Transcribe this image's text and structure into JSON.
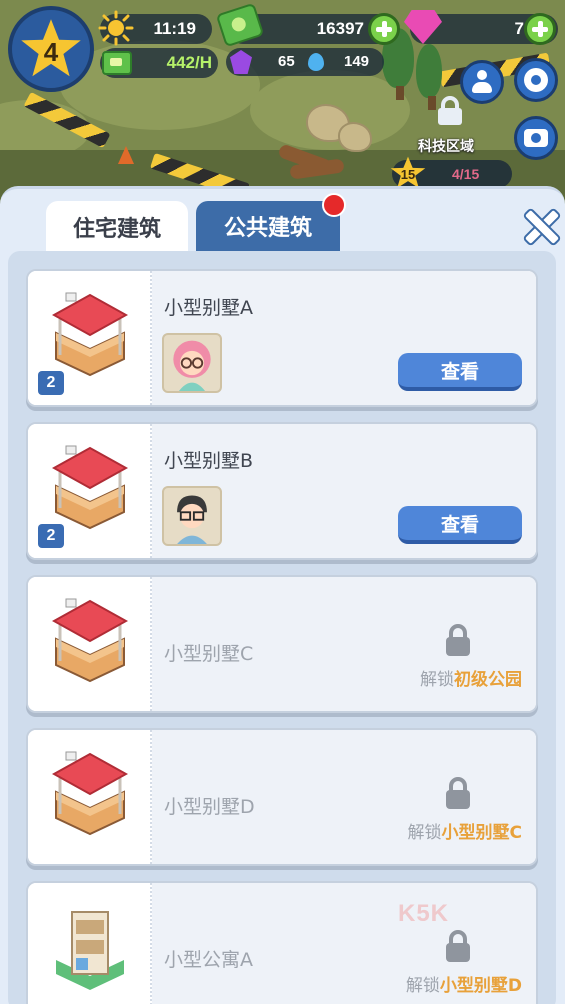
{
  "hud": {
    "level": "4",
    "time": "11:19",
    "income_rate": "442/H",
    "money": "16397",
    "gems": "7",
    "crystals": "65",
    "water": "149"
  },
  "map": {
    "zone_label": "科技区域",
    "zone_level": "15",
    "zone_progress": "4/15"
  },
  "panel": {
    "tabs": [
      {
        "label": "住宅建筑",
        "active": true
      },
      {
        "label": "公共建筑",
        "active": false,
        "has_notification": true
      }
    ],
    "buildings": [
      {
        "name": "小型别墅A",
        "count": "2",
        "status": "owned",
        "action_label": "查看",
        "avatar": "woman-pink-hair"
      },
      {
        "name": "小型别墅B",
        "count": "2",
        "status": "owned",
        "action_label": "查看",
        "avatar": "man-glasses"
      },
      {
        "name": "小型别墅C",
        "status": "locked",
        "unlock_prefix": "解锁",
        "unlock_requirement": "初级公园"
      },
      {
        "name": "小型别墅D",
        "status": "locked",
        "unlock_prefix": "解锁",
        "unlock_requirement": "小型别墅C"
      },
      {
        "name": "小型公寓A",
        "status": "locked",
        "unlock_prefix": "解锁",
        "unlock_requirement": "小型别墅D"
      }
    ]
  },
  "watermark": "K5K",
  "colors": {
    "accent_blue": "#4f86d9",
    "tab_blue": "#3d6ca8",
    "unlock_orange": "#e8a13a",
    "income_green": "#b6f26a"
  }
}
